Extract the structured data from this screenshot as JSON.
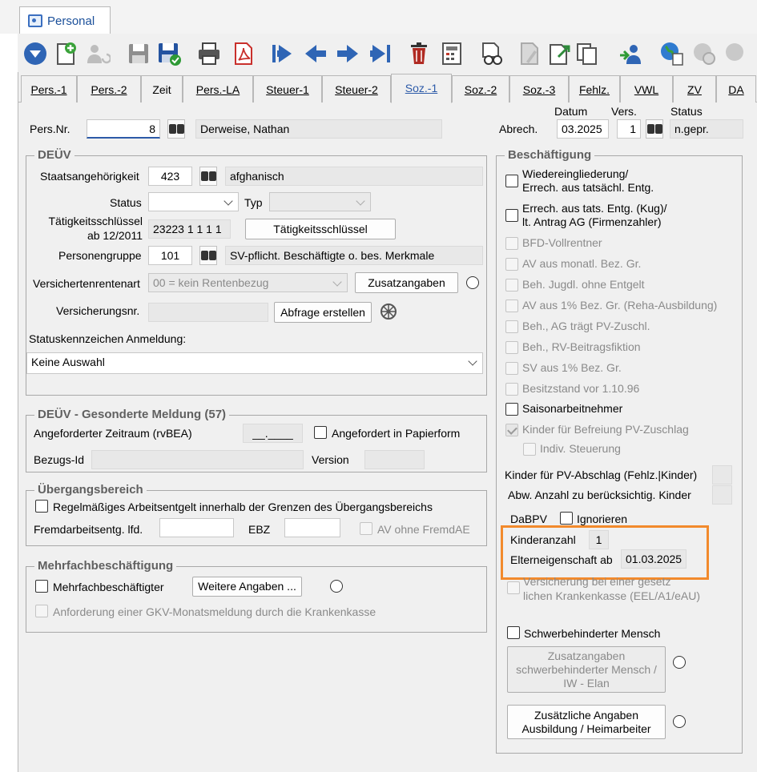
{
  "window_tab": {
    "label": "Personal"
  },
  "toolbar": {
    "icons": [
      "down-circle-icon",
      "new-document-icon",
      "users-refresh-icon",
      "save-icon",
      "save-confirm-icon",
      "print-icon",
      "pdf-icon",
      "first-record-icon",
      "prev-record-icon",
      "next-record-icon",
      "last-record-icon",
      "delete-icon",
      "calculator-icon",
      "search-document-icon",
      "document-edit-icon",
      "document-export-icon",
      "copy-icon",
      "user-import-icon",
      "globe-document-icon",
      "globe-gear-icon"
    ]
  },
  "tabs": [
    "Pers.-1",
    "Pers.-2",
    "Zeit",
    "Pers.-LA",
    "Steuer-1",
    "Steuer-2",
    "Soz.-1",
    "Soz.-2",
    "Soz.-3",
    "Fehlz.",
    "VWL",
    "ZV",
    "DA"
  ],
  "header": {
    "pers_nr_label": "Pers.Nr.",
    "pers_nr_value": "8",
    "name_value": "Derweise, Nathan",
    "datum_label": "Datum",
    "vers_label": "Vers.",
    "status_label": "Status",
    "abrech_label": "Abrech.",
    "datum_value": "03.2025",
    "vers_value": "1",
    "status_value": "n.gepr."
  },
  "deuev": {
    "title": "DEÜV",
    "staatsangehoerigkeit_label": "Staatsangehörigkeit",
    "staatsangehoerigkeit_code": "423",
    "staatsangehoerigkeit_text": "afghanisch",
    "status_label": "Status",
    "status_value": "",
    "typ_label": "Typ",
    "typ_value": "",
    "taetigkeit_label_1": "Tätigkeitsschlüssel",
    "taetigkeit_label_2": "ab 12/2011",
    "taetigkeit_value": "23223 1 1 1 1",
    "taetigkeit_button": "Tätigkeitsschlüssel",
    "personengruppe_label": "Personengruppe",
    "personengruppe_code": "101",
    "personengruppe_text": "SV-pflicht. Beschäftigte o. bes. Merkmale",
    "rentenart_label": "Versichertenrentenart",
    "rentenart_value": "00 = kein Rentenbezug",
    "zusatzangaben_button": "Zusatzangaben",
    "versicherungsnr_label": "Versicherungsnr.",
    "versicherungsnr_value": "",
    "abfrage_button": "Abfrage erstellen",
    "statuskennzeichen_label": "Statuskennzeichen Anmeldung:",
    "statuskennzeichen_value": "Keine Auswahl"
  },
  "gesonderte": {
    "title": "DEÜV - Gesonderte Meldung (57)",
    "zeitraum_label": "Angeforderter Zeitraum (rvBEA)",
    "zeitraum_value": "__.____",
    "papierform_label": "Angefordert in Papierform",
    "bezugs_label": "Bezugs-Id",
    "version_label": "Version"
  },
  "uebergang": {
    "title": "Übergangsbereich",
    "regel_label": "Regelmäßiges Arbeitsentgelt innerhalb der Grenzen des Übergangsbereichs",
    "fremd_label": "Fremdarbeitsentg. lfd.",
    "ebz_label": "EBZ",
    "av_label": "AV ohne FremdAE"
  },
  "mehrfach": {
    "title": "Mehrfachbeschäftigung",
    "mehrfach_label": "Mehrfachbeschäftigter",
    "weitere_button": "Weitere Angaben ...",
    "gkv_label": "Anforderung einer GKV-Monatsmeldung durch die Krankenkasse"
  },
  "beschaeftigung": {
    "title": "Beschäftigung",
    "items": [
      {
        "l1": "Wiedereingliederung/",
        "l2": "Errech. aus tatsächl. Entg."
      },
      {
        "l1": "Errech. aus tats. Entg. (Kug)/",
        "l2": "lt. Antrag AG (Firmenzahler)"
      },
      {
        "l1": "BFD-Vollrentner"
      },
      {
        "l1": "AV aus monatl. Bez. Gr."
      },
      {
        "l1": "Beh. Jugdl. ohne Entgelt"
      },
      {
        "l1": "AV aus 1% Bez. Gr. (Reha-Ausbildung)"
      },
      {
        "l1": "Beh., AG trägt PV-Zuschl."
      },
      {
        "l1": "Beh., RV-Beitragsfiktion"
      },
      {
        "l1": "SV aus 1% Bez. Gr."
      },
      {
        "l1": "Besitzstand vor 1.10.96"
      },
      {
        "l1": "Saisonarbeitnehmer"
      },
      {
        "l1": "Kinder für Befreiung PV-Zuschlag"
      },
      {
        "l1": "Indiv. Steuerung"
      }
    ],
    "pv_abschlag_label": "Kinder für PV-Abschlag (Fehlz.|Kinder)",
    "abw_anzahl_label": "Abw. Anzahl zu berücksichtig. Kinder",
    "dabpv_label": "DaBPV",
    "ignorieren_label": "Ignorieren",
    "kinderanzahl_label": "Kinderanzahl",
    "kinderanzahl_value": "1",
    "elterneigenschaft_label": "Elterneigenschaft ab",
    "elterneigenschaft_value": "01.03.2025",
    "versicherung_l1": "Versicherung bei einer gesetz",
    "versicherung_l2": "lichen Krankenkasse (EEL/A1/eAU)",
    "schwerbehindert_label": "Schwerbehinderter Mensch",
    "schwer_btn_l1": "Zusatzangaben",
    "schwer_btn_l2": "schwerbehinderter Mensch /",
    "schwer_btn_l3": "IW - Elan",
    "ausbildung_btn_l1": "Zusätzliche Angaben",
    "ausbildung_btn_l2": "Ausbildung / Heimarbeiter"
  },
  "colors": {
    "accent": "#2c5aa8",
    "highlight": "#f28a2c",
    "panel": "#f0f0f0"
  }
}
